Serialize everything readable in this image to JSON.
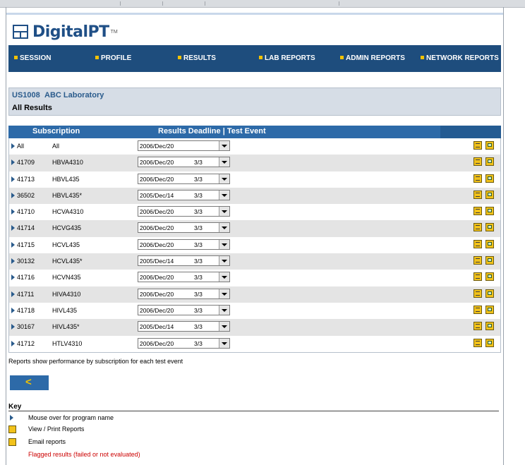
{
  "logo": {
    "text": "DigitalPT",
    "tm": "TM"
  },
  "nav": [
    {
      "label": "SESSION"
    },
    {
      "label": "PROFILE"
    },
    {
      "label": "RESULTS"
    },
    {
      "label": "LAB REPORTS"
    },
    {
      "label": "ADMIN REPORTS"
    },
    {
      "label": "NETWORK REPORTS"
    }
  ],
  "lab": {
    "id": "US1008",
    "name": "ABC Laboratory",
    "page_title": "All Results"
  },
  "table": {
    "col_subscription": "Subscription",
    "col_deadline": "Results Deadline | Test Event",
    "rows": [
      {
        "code": "All",
        "program": "All",
        "date": "2006/Dec/20",
        "event": ""
      },
      {
        "code": "41709",
        "program": "HBVA4310",
        "date": "2006/Dec/20",
        "event": "3/3"
      },
      {
        "code": "41713",
        "program": "HBVL435",
        "date": "2006/Dec/20",
        "event": "3/3"
      },
      {
        "code": "36502",
        "program": "HBVL435*",
        "date": "2005/Dec/14",
        "event": "3/3"
      },
      {
        "code": "41710",
        "program": "HCVA4310",
        "date": "2006/Dec/20",
        "event": "3/3"
      },
      {
        "code": "41714",
        "program": "HCVG435",
        "date": "2006/Dec/20",
        "event": "3/3"
      },
      {
        "code": "41715",
        "program": "HCVL435",
        "date": "2006/Dec/20",
        "event": "3/3"
      },
      {
        "code": "30132",
        "program": "HCVL435*",
        "date": "2005/Dec/14",
        "event": "3/3"
      },
      {
        "code": "41716",
        "program": "HCVN435",
        "date": "2006/Dec/20",
        "event": "3/3"
      },
      {
        "code": "41711",
        "program": "HIVA4310",
        "date": "2006/Dec/20",
        "event": "3/3"
      },
      {
        "code": "41718",
        "program": "HIVL435",
        "date": "2006/Dec/20",
        "event": "3/3"
      },
      {
        "code": "30167",
        "program": "HIVL435*",
        "date": "2005/Dec/14",
        "event": "3/3"
      },
      {
        "code": "41712",
        "program": "HTLV4310",
        "date": "2006/Dec/20",
        "event": "3/3"
      }
    ]
  },
  "note": "Reports show performance by subscription for each test event",
  "back_icon": "<",
  "key": {
    "title": "Key",
    "items": [
      {
        "icon": "arrow-icon",
        "text": "Mouse over for program name"
      },
      {
        "icon": "view-print-icon",
        "text": "View / Print Reports"
      },
      {
        "icon": "email-icon",
        "text": "Email reports"
      },
      {
        "icon": "",
        "text": "Flagged results (failed or not evaluated)"
      }
    ]
  },
  "colors": {
    "nav_bg": "#1e4d7d",
    "header_bg": "#2d6aa8",
    "accent": "#f3c200",
    "flag": "#cc0000"
  }
}
